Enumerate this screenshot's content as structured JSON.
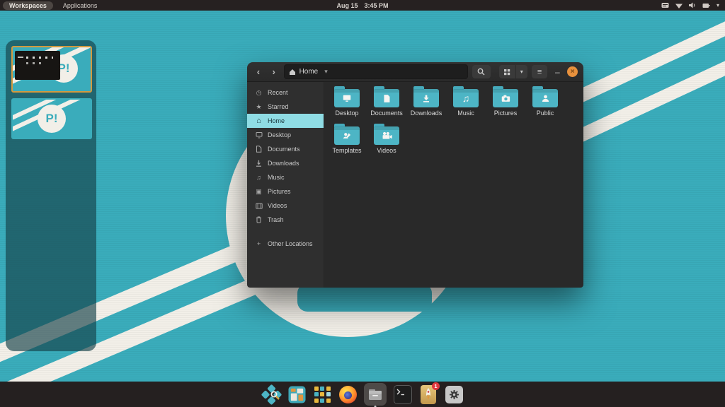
{
  "topbar": {
    "workspaces_label": "Workspaces",
    "applications_label": "Applications",
    "date": "Aug 15",
    "time": "3:45 PM"
  },
  "glyphs": {
    "back": "‹",
    "forward": "›",
    "caret_down": "▾",
    "menu": "≡",
    "minimize": "–",
    "close": "×",
    "recent": "◷",
    "star": "★",
    "home": "⌂",
    "music": "♫",
    "pictures": "▣",
    "plus": "+",
    "terminal_prompt": "❯_"
  },
  "colors": {
    "wallpaper_teal": "#3aacbb",
    "wallpaper_white": "#f2efe8",
    "selection_teal": "#8fdce4",
    "folder_teal": "#4db5c5",
    "close_button_orange": "#e8913d",
    "workspace_border_orange": "#d29a3f",
    "badge_red": "#e0393f"
  },
  "workspace_switcher": {
    "logo_text": "P!",
    "workspaces": [
      {
        "label": "workspace-1",
        "active": true
      },
      {
        "label": "workspace-2",
        "active": false
      }
    ]
  },
  "window": {
    "headerbar": {
      "path_label": "Home"
    },
    "sidebar": {
      "items": [
        {
          "label": "Recent"
        },
        {
          "label": "Starred"
        },
        {
          "label": "Home",
          "selected": true
        },
        {
          "label": "Desktop"
        },
        {
          "label": "Documents"
        },
        {
          "label": "Downloads"
        },
        {
          "label": "Music"
        },
        {
          "label": "Pictures"
        },
        {
          "label": "Videos"
        },
        {
          "label": "Trash"
        },
        {
          "label": "Other Locations"
        }
      ]
    },
    "files": {
      "items": [
        {
          "label": "Desktop",
          "emblem": "desktop"
        },
        {
          "label": "Documents",
          "emblem": "document"
        },
        {
          "label": "Downloads",
          "emblem": "download"
        },
        {
          "label": "Music",
          "emblem": "music"
        },
        {
          "label": "Pictures",
          "emblem": "camera"
        },
        {
          "label": "Public",
          "emblem": "person"
        },
        {
          "label": "Templates",
          "emblem": "template"
        },
        {
          "label": "Videos",
          "emblem": "video"
        }
      ]
    }
  },
  "dock": {
    "items": [
      {
        "name": "pop-launcher"
      },
      {
        "name": "workspaces-overview"
      },
      {
        "name": "app-grid"
      },
      {
        "name": "firefox"
      },
      {
        "name": "files",
        "active": true
      },
      {
        "name": "terminal"
      },
      {
        "name": "pop-shop",
        "badge": "1"
      },
      {
        "name": "settings"
      }
    ]
  }
}
